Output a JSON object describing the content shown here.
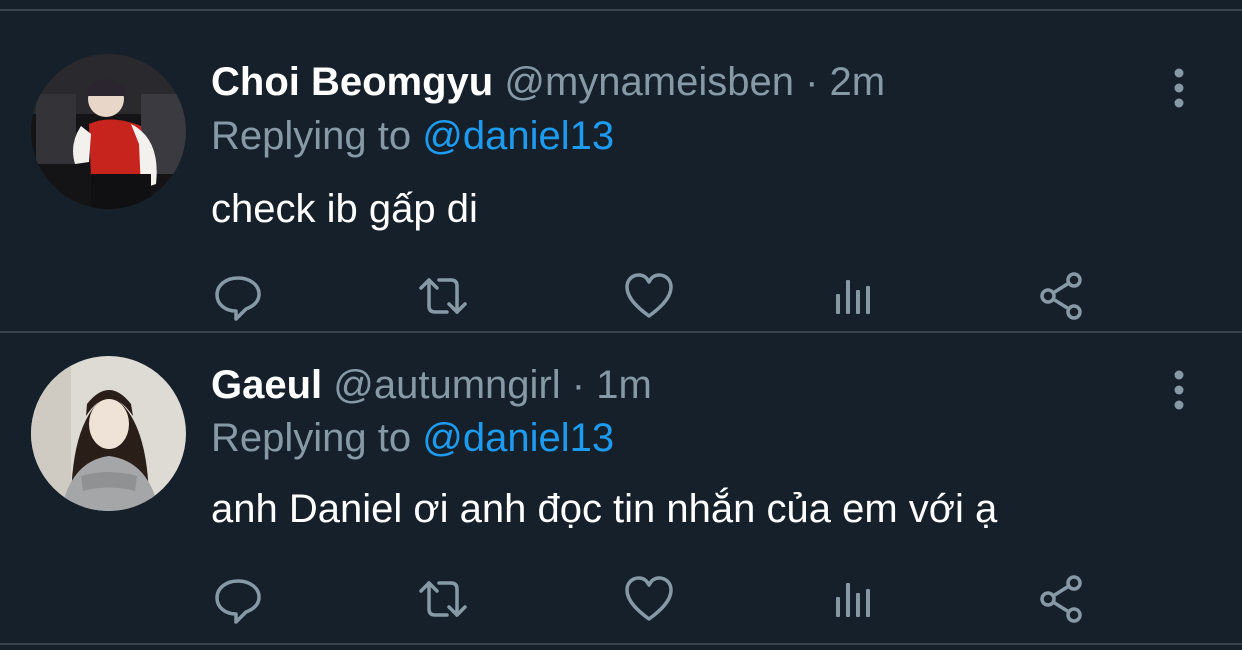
{
  "tweets": [
    {
      "name": "Choi Beomgyu",
      "handle": "@mynameisben",
      "separator": "·",
      "time": "2m",
      "replying_prefix": "Replying to",
      "replying_handle": "@daniel13",
      "text": "check ib gấp di"
    },
    {
      "name": "Gaeul",
      "handle": "@autumngirl",
      "separator": "·",
      "time": "1m",
      "replying_prefix": "Replying to",
      "replying_handle": "@daniel13",
      "text": "anh Daniel ơi anh đọc tin nhắn của em với ạ"
    }
  ],
  "icons": {
    "reply": "reply-icon",
    "retweet": "retweet-icon",
    "like": "heart-icon",
    "analytics": "analytics-icon",
    "share": "share-icon",
    "more": "more-vertical-icon"
  },
  "colors": {
    "background": "#15202b",
    "divider": "#38444d",
    "secondary_text": "#8899a6",
    "mention": "#1d9bf0",
    "primary_text": "#ffffff"
  }
}
